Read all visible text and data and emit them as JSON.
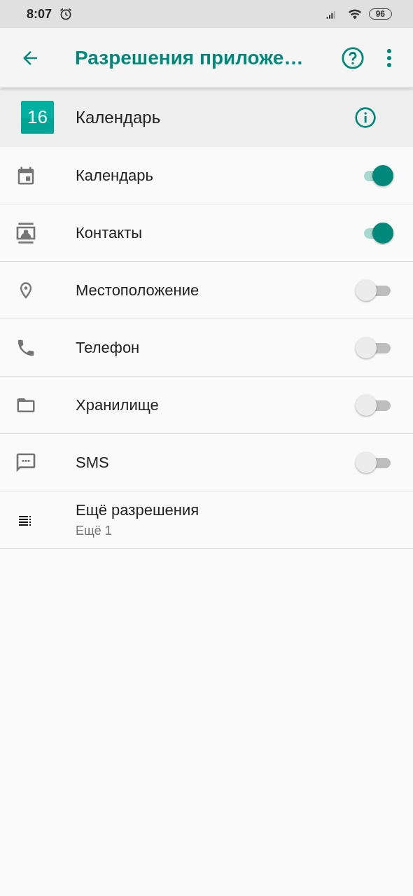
{
  "status_bar": {
    "time": "8:07",
    "battery": "96"
  },
  "app_bar": {
    "title": "Разрешения приложе…"
  },
  "app_header": {
    "icon_text": "16",
    "name": "Календарь"
  },
  "permissions": [
    {
      "kind": "toggle",
      "label": "Календарь",
      "on": true
    },
    {
      "kind": "toggle",
      "label": "Контакты",
      "on": true
    },
    {
      "kind": "toggle",
      "label": "Местоположение",
      "on": false
    },
    {
      "kind": "toggle",
      "label": "Телефон",
      "on": false
    },
    {
      "kind": "toggle",
      "label": "Хранилище",
      "on": false
    },
    {
      "kind": "toggle",
      "label": "SMS",
      "on": false
    },
    {
      "kind": "more",
      "label": "Ещё разрешения",
      "subtitle": "Ещё 1"
    }
  ]
}
